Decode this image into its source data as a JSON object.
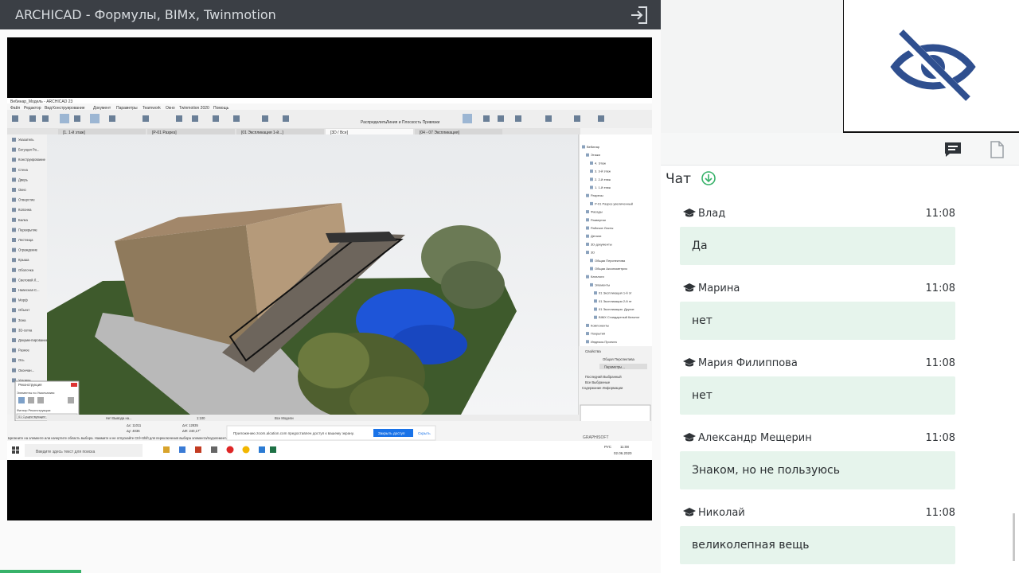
{
  "header": {
    "title": "ARCHICAD - Формулы, BIMx, Twinmotion"
  },
  "icons": {
    "exit": "exit-icon",
    "camera_off": "eye-off-icon",
    "chat": "chat-icon",
    "document": "document-icon",
    "download": "arrow-down-circle-icon",
    "user_badge": "graduation-cap-icon"
  },
  "colors": {
    "header_bg": "#3b3f45",
    "bubble_bg": "#e6f4ec",
    "accent": "#38b26a",
    "camera_icon": "#2f4f8f"
  },
  "chat": {
    "title": "Чат",
    "messages": [
      {
        "author": "Влад",
        "time": "11:08",
        "text": "Да"
      },
      {
        "author": "Марина",
        "time": "11:08",
        "text": "нет"
      },
      {
        "author": "Мария Филиппова",
        "time": "11:08",
        "text": "нет"
      },
      {
        "author": "Александр Мещерин",
        "time": "11:08",
        "text": "Знаком, но не пользуюсь"
      },
      {
        "author": "Николай",
        "time": "11:08",
        "text": "великолепная вещь"
      }
    ]
  },
  "screen": {
    "window_title": "Вебинар_Модель - ARCHICAD 23",
    "menu": [
      "Файл",
      "Редактор",
      "Вид",
      "Конструирование",
      "Документ",
      "Параметры",
      "Teamwork",
      "Окно",
      "Twinmotion 2020",
      "Помощь"
    ],
    "tabs": [
      "[1. 1-й этаж]",
      "[Р-01 Разрез]",
      "[01 Экспликация 1-й...]",
      "[3D / Все]",
      "[04 - 07 Экспликация]"
    ],
    "toolbox": [
      "Указатель",
      "Бегущая Ра...",
      "Конструирование",
      "Стена",
      "Дверь",
      "Окно",
      "Отверстие",
      "Колонна",
      "Балка",
      "Перекрытие",
      "Лестница",
      "Ограждение",
      "Крыша",
      "Оболочка",
      "Световой Л...",
      "Навесная С...",
      "Морф",
      "Объект",
      "Зона",
      "3D-сетка",
      "Документирование",
      "Разное",
      "Ось",
      "Окончан...",
      "Угловое..."
    ],
    "navigator": [
      "Вебинар",
      "Этажи",
      "4. Этаж",
      "3. 3-й этаж",
      "2. 2-й этаж",
      "1. 1-й этаж",
      "Разрезы",
      "Р-01 Разрез увеличенный",
      "Фасады",
      "Развертки",
      "Рабочие Листы",
      "Детали",
      "3D-документы",
      "3D",
      "Общая Перспектива",
      "Общая Аксонометрия",
      "Каталоги",
      "Элементы",
      "01 Экспликация 1-й эт",
      "01 Экспликация 2-й эт",
      "01 Экспликация. Другое",
      "BIMX Стандартный Каталог",
      "Компоненты",
      "Покрытия",
      "Индексы Проекта"
    ],
    "properties_title": "Свойства",
    "properties_value": "Общая Перспектива",
    "properties_button": "Параметры...",
    "options": [
      "Последний Выбранный",
      "Все Выбранные",
      "Содержание Информации"
    ],
    "reconstruction": {
      "title": "Реконструкция",
      "line1": "Элементы по Умолчанию:",
      "line2": "Фильтр Реконструкции:",
      "value": "01 Существующее состояние"
    },
    "status": "Щелкните на элементе или начертите область выбора. Нажмите и не отпускайте Ctrl+Shift для переключения выбора элемента/подэлемента.",
    "notice_text": "Приложению zoom.alcation.com предоставлен доступ к вашему экрану.",
    "notice_button": "Закрыть доступ",
    "notice_hide": "Скрыть",
    "search_placeholder": "Введите здесь текст для поиска",
    "tray_time": "11:08",
    "tray_date": "02.06.2020",
    "tray_lang": "РУС",
    "brand": "GRAPHISOFT",
    "bottom_left": "Нет Вывода на...",
    "bottom_center": "Все Модели",
    "toolbar_left": "Распределить",
    "toolbar_right": "Линия и Плоскость Привязки",
    "scale": "1:100",
    "coord_a": "Δх: 11011",
    "coord_b": "Δу: 4036",
    "coord_c": "ΔН: 12835",
    "coord_d": "ΔΦ: 240,17°"
  }
}
